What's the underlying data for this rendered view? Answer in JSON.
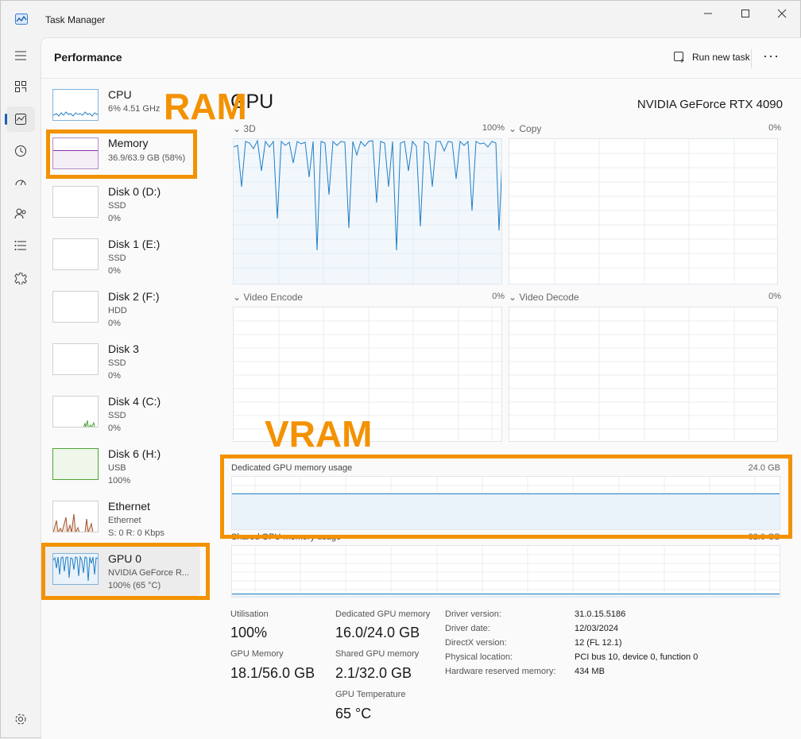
{
  "window": {
    "title": "Task Manager",
    "icon": "task-manager-icon",
    "buttons": [
      "minimize-icon",
      "maximize-icon",
      "close-icon"
    ]
  },
  "nav": {
    "items": [
      "hamburger-icon",
      "processes-icon",
      "performance-icon",
      "app-history-icon",
      "startup-apps-icon",
      "users-icon",
      "details-icon",
      "services-icon"
    ],
    "settings": "settings-icon",
    "active": "performance-icon"
  },
  "header": {
    "title": "Performance",
    "run_new_task": "Run new task",
    "more": "···"
  },
  "sidebar": {
    "items": [
      {
        "name": "CPU",
        "l1": "6% 4.51 GHz",
        "l2": ""
      },
      {
        "name": "Memory",
        "l1": "36.9/63.9 GB (58%)",
        "l2": ""
      },
      {
        "name": "Disk 0 (D:)",
        "l1": "SSD",
        "l2": "0%"
      },
      {
        "name": "Disk 1 (E:)",
        "l1": "SSD",
        "l2": "0%"
      },
      {
        "name": "Disk 2 (F:)",
        "l1": "HDD",
        "l2": "0%"
      },
      {
        "name": "Disk 3",
        "l1": "SSD",
        "l2": "0%"
      },
      {
        "name": "Disk 4 (C:)",
        "l1": "SSD",
        "l2": "0%"
      },
      {
        "name": "Disk 6 (H:)",
        "l1": "USB",
        "l2": "100%"
      },
      {
        "name": "Ethernet",
        "l1": "Ethernet",
        "l2": "S: 0 R: 0 Kbps"
      },
      {
        "name": "GPU 0",
        "l1": "NVIDIA GeForce R...",
        "l2": "100% (65 °C)"
      }
    ],
    "selected": "GPU 0",
    "memory_usage_fraction": 0.58,
    "disk6_usage_fraction": 1.0
  },
  "main": {
    "title": "GPU",
    "device": "NVIDIA GeForce RTX 4090",
    "engines": [
      {
        "name": "3D",
        "max": "100%"
      },
      {
        "name": "Copy",
        "max": "0%"
      },
      {
        "name": "Video Encode",
        "max": "0%"
      },
      {
        "name": "Video Decode",
        "max": "0%"
      }
    ],
    "dedicated": {
      "label": "Dedicated GPU memory usage",
      "max": "24.0 GB",
      "fraction": 0.667
    },
    "shared": {
      "label": "Shared GPU memory usage",
      "max": "32.0 GB"
    },
    "stats": {
      "utilisation_label": "Utilisation",
      "utilisation": "100%",
      "gpu_memory_label": "GPU Memory",
      "gpu_memory": "18.1/56.0 GB",
      "dedicated_label": "Dedicated GPU memory",
      "dedicated": "16.0/24.0 GB",
      "shared_label": "Shared GPU memory",
      "shared": "2.1/32.0 GB",
      "temp_label": "GPU Temperature",
      "temp": "65 °C"
    },
    "info": [
      {
        "label": "Driver version:",
        "value": "31.0.15.5186"
      },
      {
        "label": "Driver date:",
        "value": "12/03/2024"
      },
      {
        "label": "DirectX version:",
        "value": "12 (FL 12.1)"
      },
      {
        "label": "Physical location:",
        "value": "PCI bus 10, device 0, function 0"
      },
      {
        "label": "Hardware reserved memory:",
        "value": "434 MB"
      }
    ]
  },
  "annotations": {
    "ram": "RAM",
    "vram": "VRAM",
    "color": "#f39200"
  },
  "colors": {
    "gpu_line": "#1f7fc4",
    "memory_line": "#8b2fa8",
    "disk_line": "#4ca434",
    "ethernet_line": "#a0522d"
  }
}
